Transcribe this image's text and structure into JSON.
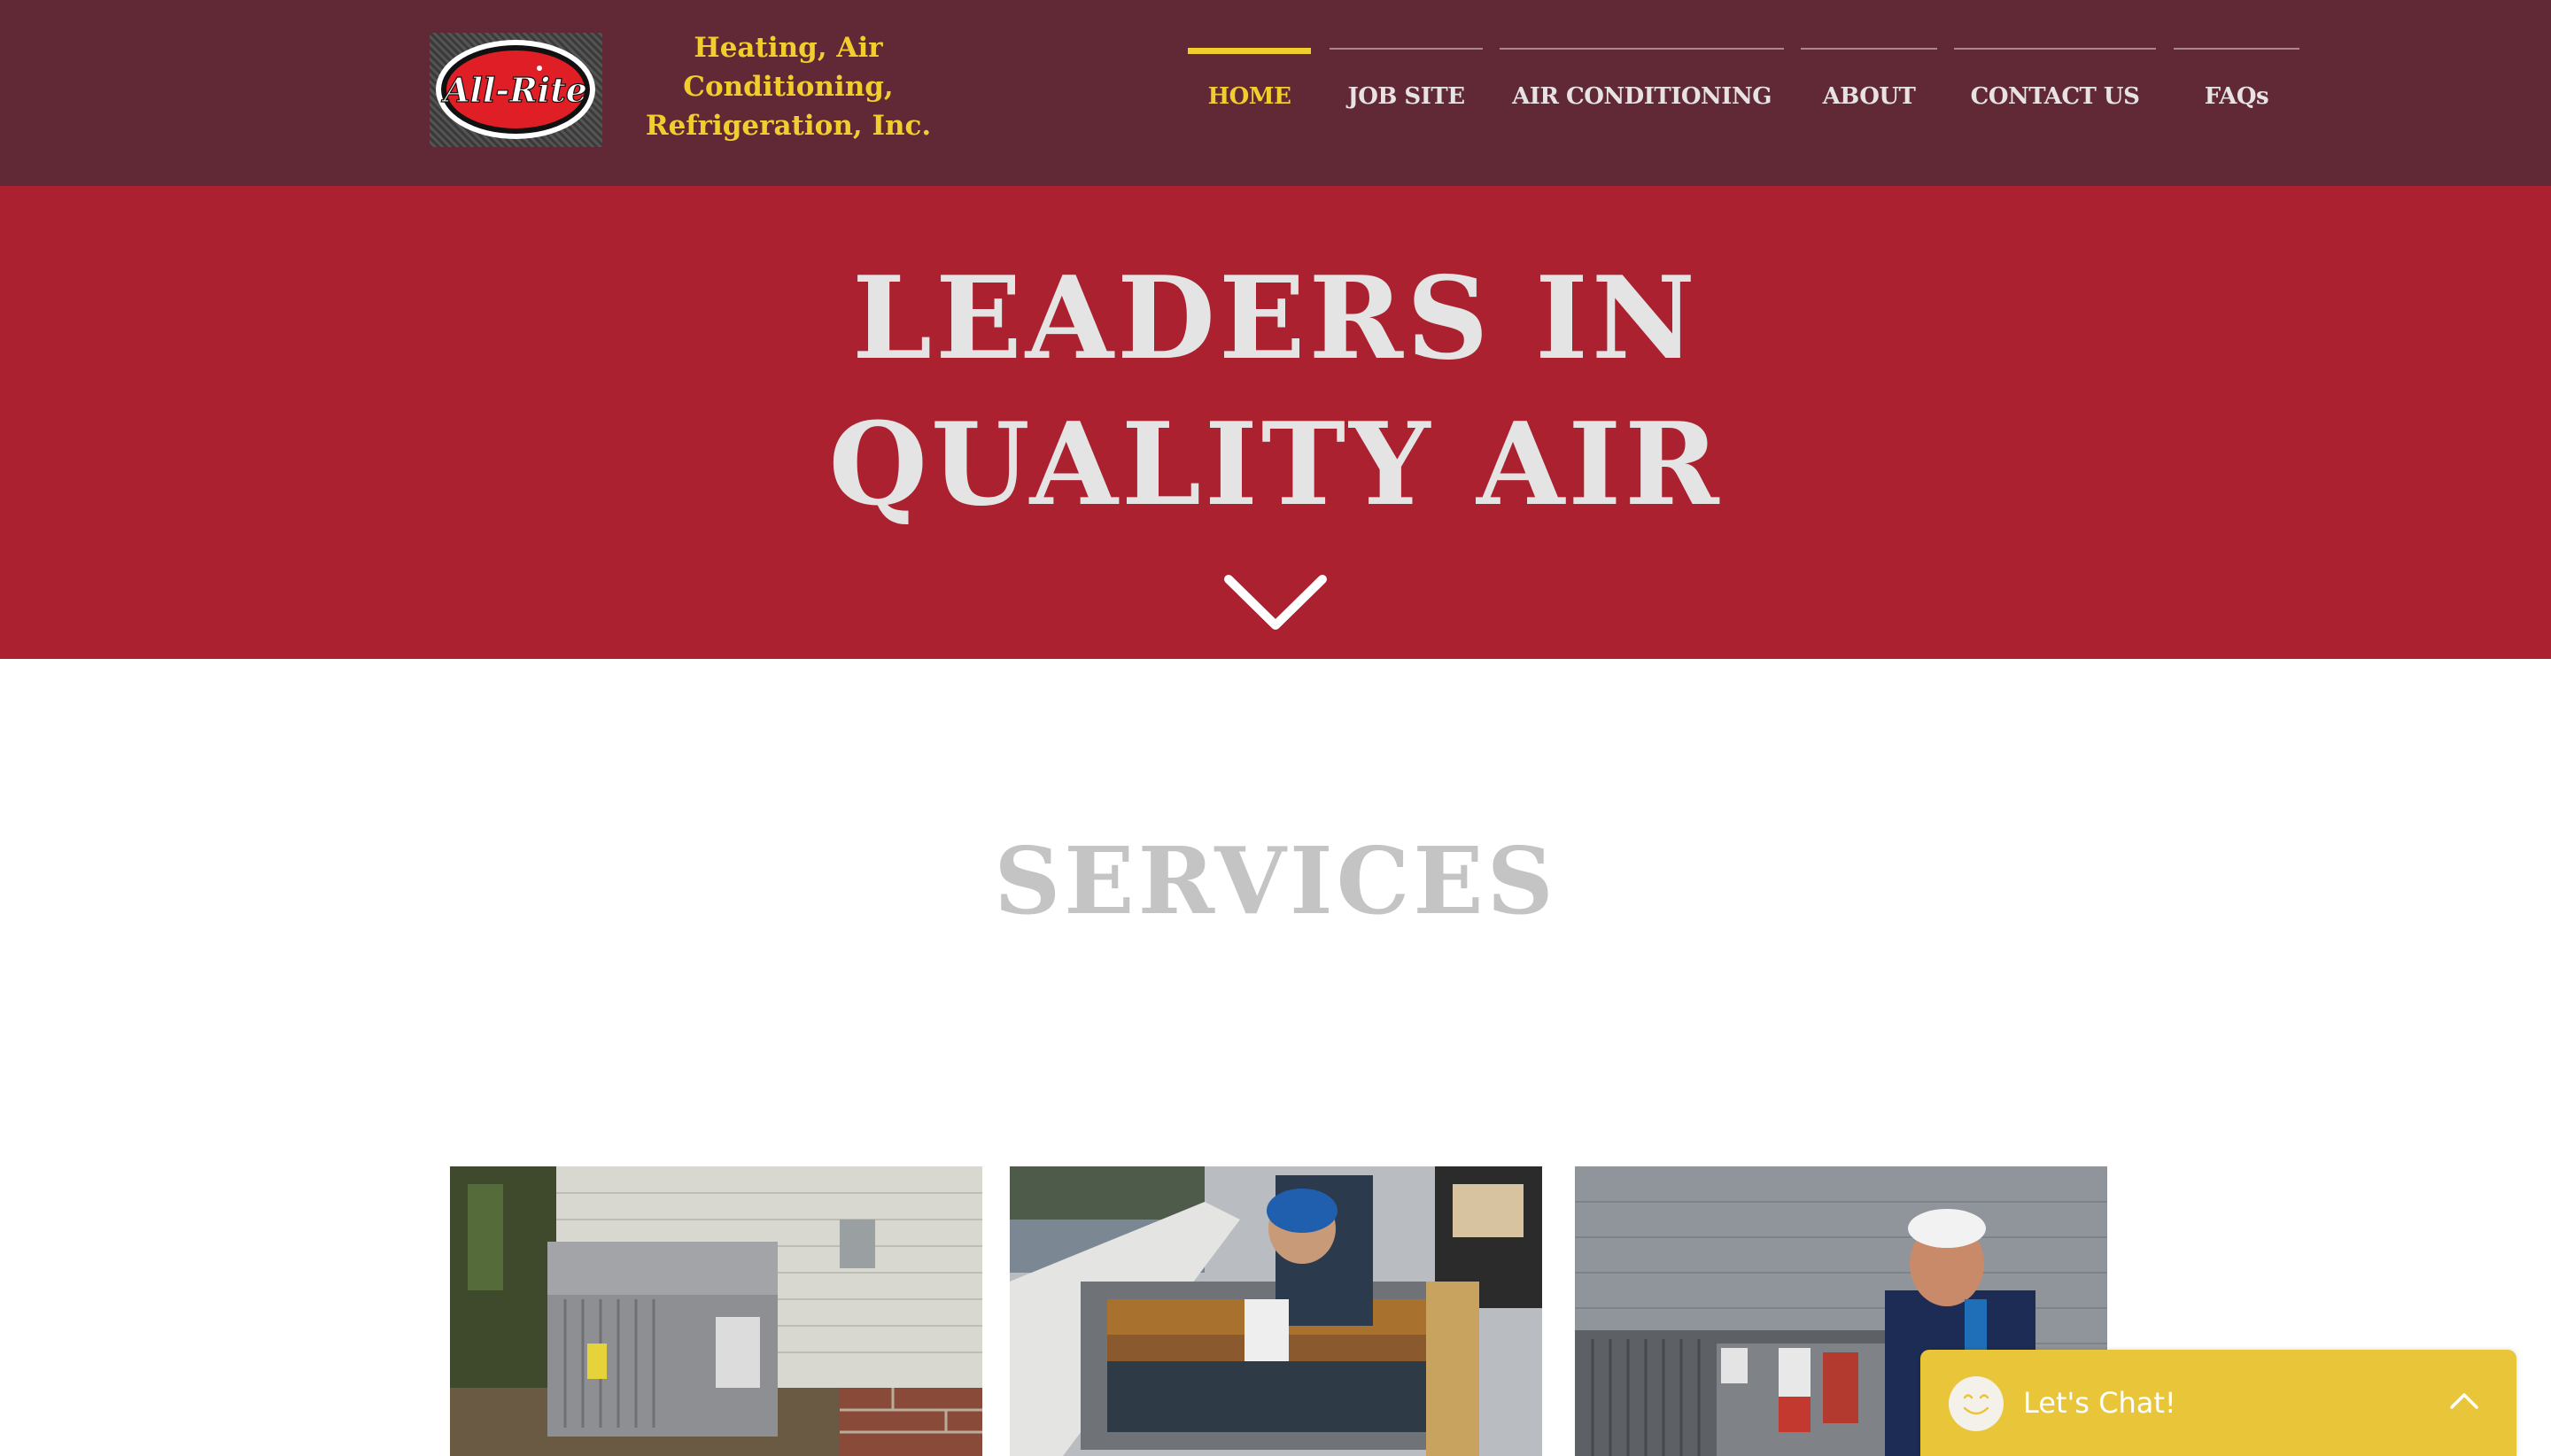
{
  "header": {
    "logo": {
      "text": "All-Rite",
      "icon": "all-rite-logo"
    },
    "company_name": {
      "line1": "Heating, Air",
      "line2": "Conditioning,",
      "line3": "Refrigeration, Inc."
    },
    "nav": {
      "items": [
        {
          "label": "HOME",
          "active": true
        },
        {
          "label": "JOB SITE",
          "active": false
        },
        {
          "label": "AIR CONDITIONING",
          "active": false
        },
        {
          "label": "ABOUT",
          "active": false
        },
        {
          "label": "CONTACT US",
          "active": false
        },
        {
          "label": "FAQs",
          "active": false
        }
      ]
    }
  },
  "hero": {
    "title_line1": "LEADERS IN",
    "title_line2": "QUALITY AIR",
    "scroll_icon": "chevron-down-icon"
  },
  "services": {
    "title": "SERVICES",
    "photos": [
      {
        "subject": "outdoor packaged air conditioning unit beside house"
      },
      {
        "subject": "technician working on rooftop unit"
      },
      {
        "subject": "technician standing beside condenser unit"
      }
    ]
  },
  "chat": {
    "label": "Let's Chat!",
    "avatar_icon": "smiley-icon",
    "toggle_icon": "chevron-up-icon"
  },
  "colors": {
    "header_bg": "#612936",
    "hero_bg": "#ab212f",
    "accent_yellow": "#f2cd2e",
    "nav_text": "#e7e2e4",
    "hero_text": "#e4e4e4",
    "services_text": "#c4c4c4",
    "chat_bg": "#e9c53a"
  }
}
